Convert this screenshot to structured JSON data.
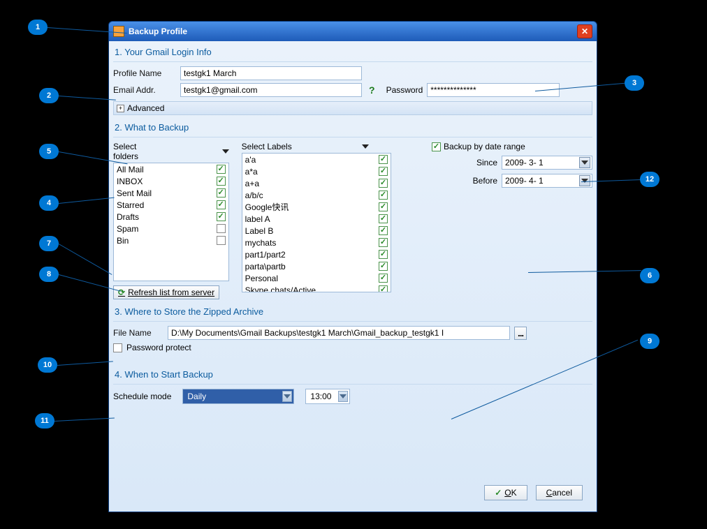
{
  "callouts": [
    "1",
    "2",
    "3",
    "4",
    "5",
    "6",
    "7",
    "8",
    "9",
    "10",
    "11",
    "12"
  ],
  "window": {
    "title": "Backup Profile"
  },
  "section1": {
    "heading": "1. Your Gmail Login Info",
    "profile_name_label": "Profile Name",
    "profile_name_value": "testgk1 March",
    "email_label": "Email Addr.",
    "email_value": "testgk1@gmail.com",
    "help_tip": "?",
    "password_label": "Password",
    "password_value": "**************",
    "advanced_label": "Advanced"
  },
  "section2": {
    "heading": "2. What to Backup",
    "folders_header": "Select folders",
    "labels_header": "Select Labels",
    "folders": [
      {
        "name": "All Mail",
        "checked": true
      },
      {
        "name": "INBOX",
        "checked": true
      },
      {
        "name": "Sent Mail",
        "checked": true
      },
      {
        "name": "Starred",
        "checked": true
      },
      {
        "name": "Drafts",
        "checked": true
      },
      {
        "name": "Spam",
        "checked": false
      },
      {
        "name": "Bin",
        "checked": false
      }
    ],
    "labels": [
      {
        "name": "a'a",
        "checked": true
      },
      {
        "name": "a*a",
        "checked": true
      },
      {
        "name": "a+a",
        "checked": true
      },
      {
        "name": "a/b/c",
        "checked": true
      },
      {
        "name": "Google快讯",
        "checked": true
      },
      {
        "name": "label A",
        "checked": true
      },
      {
        "name": "Label B",
        "checked": true
      },
      {
        "name": "mychats",
        "checked": true
      },
      {
        "name": "part1/part2",
        "checked": true
      },
      {
        "name": "parta\\partb",
        "checked": true
      },
      {
        "name": "Personal",
        "checked": true
      },
      {
        "name": "Skype chats/Active",
        "checked": true
      }
    ],
    "refresh_label": "Refresh list from server",
    "backup_range_label": "Backup by date range",
    "backup_range_checked": true,
    "since_label": "Since",
    "since_value": "2009- 3- 1",
    "before_label": "Before",
    "before_value": "2009- 4- 1"
  },
  "section3": {
    "heading": "3. Where to Store the Zipped Archive",
    "filename_label": "File Name",
    "filename_value": "D:\\My Documents\\Gmail Backups\\testgk1 March\\Gmail_backup_testgk1 I",
    "browse_label": "...",
    "pw_protect_label": "Password protect",
    "pw_protect_checked": false
  },
  "section4": {
    "heading": "4. When to Start Backup",
    "schedule_label": "Schedule mode",
    "schedule_value": "Daily",
    "time_value": "13:00"
  },
  "buttons": {
    "ok_underline": "O",
    "ok_rest": "K",
    "cancel_underline": "C",
    "cancel_rest": "ancel"
  }
}
